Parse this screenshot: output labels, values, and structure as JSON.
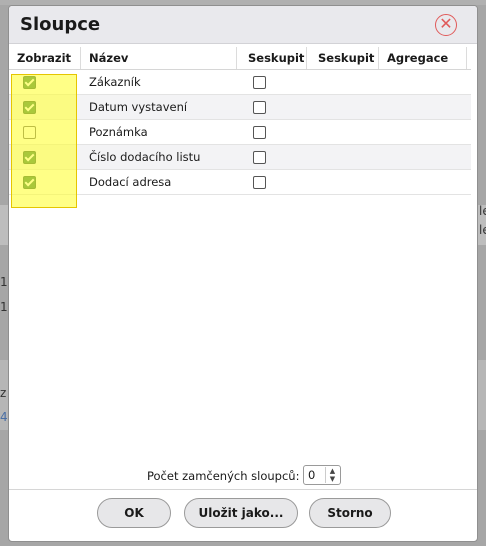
{
  "dialog": {
    "title": "Sloupce",
    "close_icon": "close-circle-icon"
  },
  "columns_table": {
    "headers": [
      "Zobrazit",
      "Název",
      "Seskupit",
      "Seskupit p",
      "Agregace"
    ],
    "rows": [
      {
        "name": "Zákazník",
        "show": true,
        "group": false
      },
      {
        "name": "Datum vystavení",
        "show": true,
        "group": false
      },
      {
        "name": "Poznámka",
        "show": false,
        "group": false
      },
      {
        "name": "Číslo dodacího listu",
        "show": true,
        "group": false
      },
      {
        "name": "Dodací adresa",
        "show": true,
        "group": false
      }
    ]
  },
  "locked_columns": {
    "label": "Počet zamčených sloupců:",
    "value": "0"
  },
  "buttons": {
    "ok": "OK",
    "save_as": "Uložit jako...",
    "cancel": "Storno"
  },
  "background": {
    "fragments": [
      "le",
      "le",
      "1",
      "1",
      "z",
      "4!"
    ]
  },
  "colors": {
    "highlight": "#ffff3c",
    "checkbox_checked": "#1e6e3a",
    "close_icon": "#e05a5a"
  }
}
